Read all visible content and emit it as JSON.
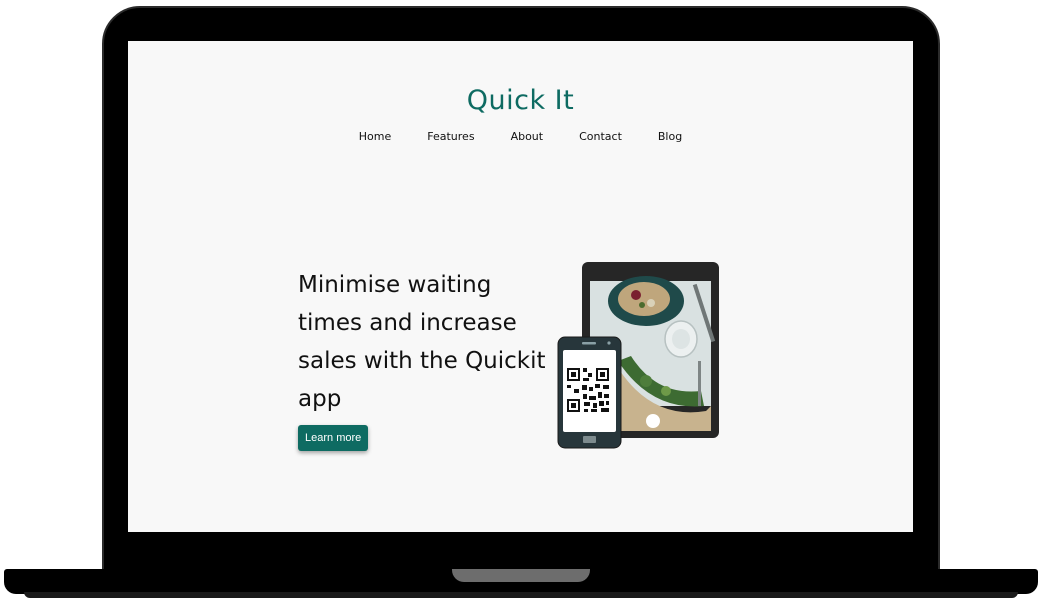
{
  "site": {
    "logo": "Quick It",
    "nav": [
      {
        "label": "Home"
      },
      {
        "label": "Features"
      },
      {
        "label": "About"
      },
      {
        "label": "Contact"
      },
      {
        "label": "Blog"
      }
    ]
  },
  "hero": {
    "headline": "Minimise waiting times and increase sales with the Quickit app",
    "cta_label": "Learn more"
  },
  "colors": {
    "brand": "#0e6b62",
    "page_background": "#f8f8f8",
    "device_frame": "#000000"
  },
  "icons": [
    "tablet-icon",
    "phone-icon",
    "qr-code-icon"
  ]
}
